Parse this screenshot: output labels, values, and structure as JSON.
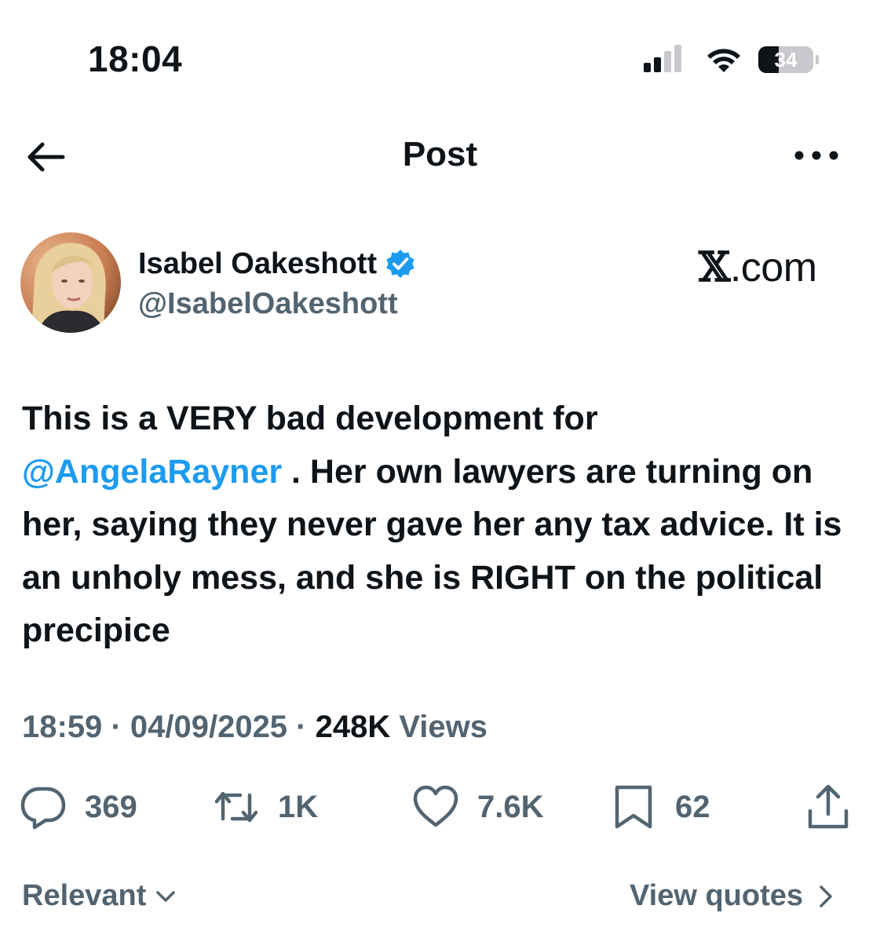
{
  "status_bar": {
    "time": "18:04",
    "battery_level": "34",
    "icons": [
      "cellular-signal-icon",
      "wifi-icon",
      "battery-icon"
    ]
  },
  "header": {
    "title": "Post",
    "back_icon": "arrow-left-icon",
    "more_icon": "more-horizontal-icon"
  },
  "author": {
    "name": "Isabel Oakeshott",
    "handle": "@IsabelOakeshott",
    "verified": true,
    "verified_color": "#1d9bf0"
  },
  "watermark": {
    "mark": "𝕏",
    "text": ".com"
  },
  "tweet": {
    "line1": "This is a VERY bad development for",
    "mention": "@AngelaRayner",
    "after_mention": " . Her own lawyers are turning on her, saying they never gave her any tax advice. It is an unholy mess, and she is RIGHT on the political precipice",
    "mention_color": "#1d9bf0"
  },
  "meta": {
    "time": "18:59",
    "sep1": " · ",
    "date": "04/09/2025",
    "sep2": " · ",
    "views_count": "248K",
    "views_label": " Views"
  },
  "actions": {
    "replies": "369",
    "reposts": "1K",
    "likes": "7.6K",
    "bookmarks": "62",
    "icons": [
      "reply-icon",
      "repost-icon",
      "like-icon",
      "bookmark-icon",
      "share-icon"
    ]
  },
  "footer": {
    "sort_label": "Relevant",
    "quotes_label": "View quotes"
  },
  "colors": {
    "text": "#0f1419",
    "secondary": "#536471",
    "accent": "#1d9bf0"
  }
}
